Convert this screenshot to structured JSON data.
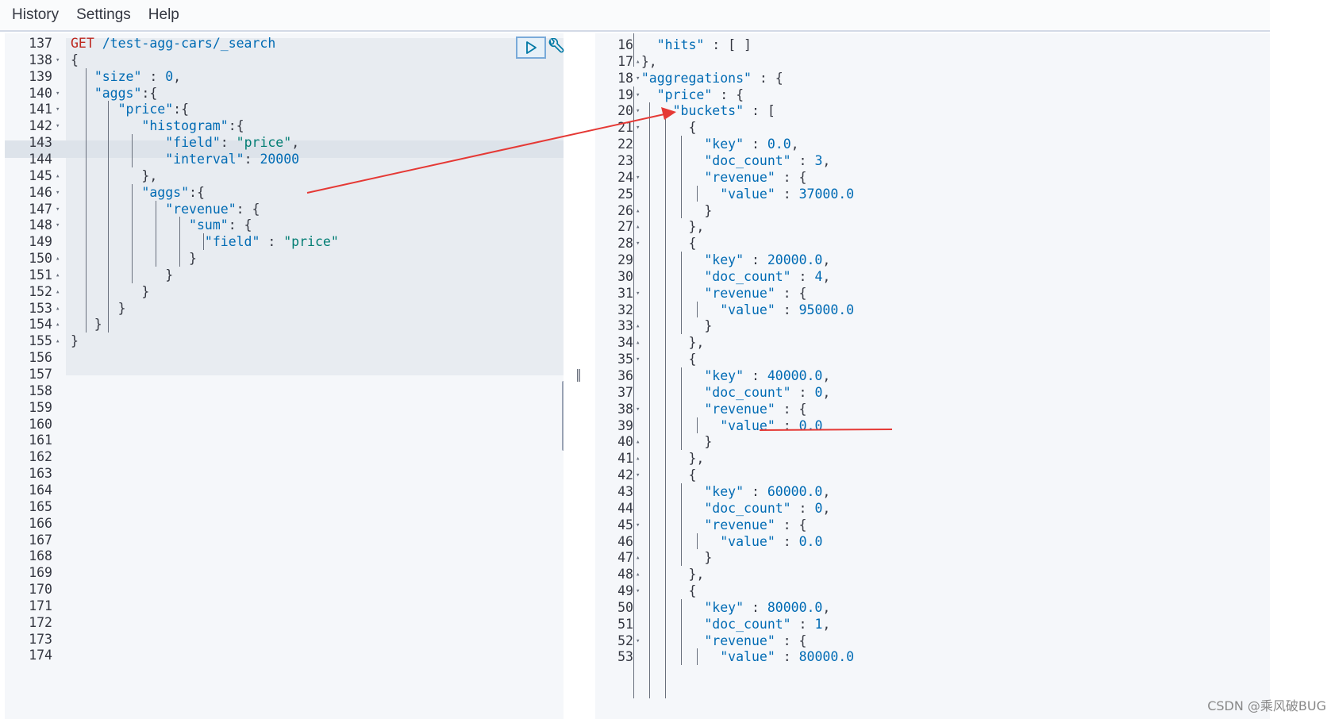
{
  "menu": [
    "History",
    "Settings",
    "Help"
  ],
  "icons": {
    "play": "play-triangle-icon",
    "wrench": "wrench-icon",
    "splitter": "drag-handle-icon"
  },
  "colors": {
    "key": "#006bb4",
    "string": "#017d73",
    "method": "#bd271e",
    "annotation": "#e53935"
  },
  "request": {
    "method": "GET",
    "url": "/test-agg-cars/_search",
    "lines": [
      {
        "n": "137",
        "fold": "",
        "t": [
          [
            "method",
            "GET"
          ],
          [
            "punc",
            " "
          ],
          [
            "url",
            "/test-agg-cars/_search"
          ]
        ]
      },
      {
        "n": "138",
        "fold": "▾",
        "t": [
          [
            "punc",
            "{"
          ]
        ]
      },
      {
        "n": "139",
        "fold": "",
        "t": [
          [
            "punc",
            "   "
          ],
          [
            "key",
            "\"size\""
          ],
          [
            "punc",
            " : "
          ],
          [
            "num",
            "0"
          ],
          [
            "punc",
            ","
          ]
        ]
      },
      {
        "n": "140",
        "fold": "▾",
        "t": [
          [
            "punc",
            "   "
          ],
          [
            "key",
            "\"aggs\""
          ],
          [
            "punc",
            ":{"
          ]
        ]
      },
      {
        "n": "141",
        "fold": "▾",
        "t": [
          [
            "punc",
            "      "
          ],
          [
            "key",
            "\"price\""
          ],
          [
            "punc",
            ":{"
          ]
        ]
      },
      {
        "n": "142",
        "fold": "▾",
        "t": [
          [
            "punc",
            "         "
          ],
          [
            "key",
            "\"histogram\""
          ],
          [
            "punc",
            ":{"
          ]
        ]
      },
      {
        "n": "143",
        "fold": "",
        "t": [
          [
            "punc",
            "            "
          ],
          [
            "key",
            "\"field\""
          ],
          [
            "punc",
            ": "
          ],
          [
            "str",
            "\"price\""
          ],
          [
            "punc",
            ","
          ]
        ]
      },
      {
        "n": "144",
        "fold": "",
        "t": [
          [
            "punc",
            "            "
          ],
          [
            "key",
            "\"interval\""
          ],
          [
            "punc",
            ": "
          ],
          [
            "num",
            "20000"
          ]
        ]
      },
      {
        "n": "145",
        "fold": "▴",
        "t": [
          [
            "punc",
            "         },"
          ]
        ]
      },
      {
        "n": "146",
        "fold": "▾",
        "t": [
          [
            "punc",
            "         "
          ],
          [
            "key",
            "\"aggs\""
          ],
          [
            "punc",
            ":{"
          ]
        ]
      },
      {
        "n": "147",
        "fold": "▾",
        "t": [
          [
            "punc",
            "            "
          ],
          [
            "key",
            "\"revenue\""
          ],
          [
            "punc",
            ": {"
          ]
        ]
      },
      {
        "n": "148",
        "fold": "▾",
        "t": [
          [
            "punc",
            "               "
          ],
          [
            "key",
            "\"sum\""
          ],
          [
            "punc",
            ": {"
          ]
        ]
      },
      {
        "n": "149",
        "fold": "",
        "t": [
          [
            "punc",
            "                 "
          ],
          [
            "key",
            "\"field\""
          ],
          [
            "punc",
            " : "
          ],
          [
            "str",
            "\"price\""
          ]
        ]
      },
      {
        "n": "150",
        "fold": "▴",
        "t": [
          [
            "punc",
            "               }"
          ]
        ]
      },
      {
        "n": "151",
        "fold": "▴",
        "t": [
          [
            "punc",
            "            }"
          ]
        ]
      },
      {
        "n": "152",
        "fold": "▴",
        "t": [
          [
            "punc",
            "         }"
          ]
        ]
      },
      {
        "n": "153",
        "fold": "▴",
        "t": [
          [
            "punc",
            "      }"
          ]
        ]
      },
      {
        "n": "154",
        "fold": "▴",
        "t": [
          [
            "punc",
            "   }"
          ]
        ]
      },
      {
        "n": "155",
        "fold": "▴",
        "t": [
          [
            "punc",
            "}"
          ]
        ]
      },
      {
        "n": "156",
        "fold": "",
        "t": []
      },
      {
        "n": "157",
        "fold": "",
        "t": []
      },
      {
        "n": "158",
        "fold": "",
        "t": []
      },
      {
        "n": "159",
        "fold": "",
        "t": []
      },
      {
        "n": "160",
        "fold": "",
        "t": []
      },
      {
        "n": "161",
        "fold": "",
        "t": []
      },
      {
        "n": "162",
        "fold": "",
        "t": []
      },
      {
        "n": "163",
        "fold": "",
        "t": []
      },
      {
        "n": "164",
        "fold": "",
        "t": []
      },
      {
        "n": "165",
        "fold": "",
        "t": []
      },
      {
        "n": "166",
        "fold": "",
        "t": []
      },
      {
        "n": "167",
        "fold": "",
        "t": []
      },
      {
        "n": "168",
        "fold": "",
        "t": []
      },
      {
        "n": "169",
        "fold": "",
        "t": []
      },
      {
        "n": "170",
        "fold": "",
        "t": []
      },
      {
        "n": "171",
        "fold": "",
        "t": []
      },
      {
        "n": "172",
        "fold": "",
        "t": []
      },
      {
        "n": "173",
        "fold": "",
        "t": []
      },
      {
        "n": "174",
        "fold": "",
        "t": []
      }
    ]
  },
  "response": {
    "lines": [
      {
        "n": "16",
        "fold": "",
        "t": [
          [
            "punc",
            "    "
          ],
          [
            "key",
            "\"hits\""
          ],
          [
            "punc",
            " : [ ]"
          ]
        ]
      },
      {
        "n": "17",
        "fold": "▴",
        "t": [
          [
            "punc",
            "  },"
          ]
        ]
      },
      {
        "n": "18",
        "fold": "▾",
        "t": [
          [
            "punc",
            "  "
          ],
          [
            "key",
            "\"aggregations\""
          ],
          [
            "punc",
            " : {"
          ]
        ]
      },
      {
        "n": "19",
        "fold": "▾",
        "t": [
          [
            "punc",
            "    "
          ],
          [
            "key",
            "\"price\""
          ],
          [
            "punc",
            " : {"
          ]
        ]
      },
      {
        "n": "20",
        "fold": "▾",
        "t": [
          [
            "punc",
            "      "
          ],
          [
            "key",
            "\"buckets\""
          ],
          [
            "punc",
            " : ["
          ]
        ]
      },
      {
        "n": "21",
        "fold": "▾",
        "t": [
          [
            "punc",
            "        {"
          ]
        ]
      },
      {
        "n": "22",
        "fold": "",
        "t": [
          [
            "punc",
            "          "
          ],
          [
            "key",
            "\"key\""
          ],
          [
            "punc",
            " : "
          ],
          [
            "num",
            "0.0"
          ],
          [
            "punc",
            ","
          ]
        ]
      },
      {
        "n": "23",
        "fold": "",
        "t": [
          [
            "punc",
            "          "
          ],
          [
            "key",
            "\"doc_count\""
          ],
          [
            "punc",
            " : "
          ],
          [
            "num",
            "3"
          ],
          [
            "punc",
            ","
          ]
        ]
      },
      {
        "n": "24",
        "fold": "▾",
        "t": [
          [
            "punc",
            "          "
          ],
          [
            "key",
            "\"revenue\""
          ],
          [
            "punc",
            " : {"
          ]
        ]
      },
      {
        "n": "25",
        "fold": "",
        "t": [
          [
            "punc",
            "            "
          ],
          [
            "key",
            "\"value\""
          ],
          [
            "punc",
            " : "
          ],
          [
            "num",
            "37000.0"
          ]
        ]
      },
      {
        "n": "26",
        "fold": "▴",
        "t": [
          [
            "punc",
            "          }"
          ]
        ]
      },
      {
        "n": "27",
        "fold": "▴",
        "t": [
          [
            "punc",
            "        },"
          ]
        ]
      },
      {
        "n": "28",
        "fold": "▾",
        "t": [
          [
            "punc",
            "        {"
          ]
        ]
      },
      {
        "n": "29",
        "fold": "",
        "t": [
          [
            "punc",
            "          "
          ],
          [
            "key",
            "\"key\""
          ],
          [
            "punc",
            " : "
          ],
          [
            "num",
            "20000.0"
          ],
          [
            "punc",
            ","
          ]
        ]
      },
      {
        "n": "30",
        "fold": "",
        "t": [
          [
            "punc",
            "          "
          ],
          [
            "key",
            "\"doc_count\""
          ],
          [
            "punc",
            " : "
          ],
          [
            "num",
            "4"
          ],
          [
            "punc",
            ","
          ]
        ]
      },
      {
        "n": "31",
        "fold": "▾",
        "t": [
          [
            "punc",
            "          "
          ],
          [
            "key",
            "\"revenue\""
          ],
          [
            "punc",
            " : {"
          ]
        ]
      },
      {
        "n": "32",
        "fold": "",
        "t": [
          [
            "punc",
            "            "
          ],
          [
            "key",
            "\"value\""
          ],
          [
            "punc",
            " : "
          ],
          [
            "num",
            "95000.0"
          ]
        ]
      },
      {
        "n": "33",
        "fold": "▴",
        "t": [
          [
            "punc",
            "          }"
          ]
        ]
      },
      {
        "n": "34",
        "fold": "▴",
        "t": [
          [
            "punc",
            "        },"
          ]
        ]
      },
      {
        "n": "35",
        "fold": "▾",
        "t": [
          [
            "punc",
            "        {"
          ]
        ]
      },
      {
        "n": "36",
        "fold": "",
        "t": [
          [
            "punc",
            "          "
          ],
          [
            "key",
            "\"key\""
          ],
          [
            "punc",
            " : "
          ],
          [
            "num",
            "40000.0"
          ],
          [
            "punc",
            ","
          ]
        ]
      },
      {
        "n": "37",
        "fold": "",
        "t": [
          [
            "punc",
            "          "
          ],
          [
            "key",
            "\"doc_count\""
          ],
          [
            "punc",
            " : "
          ],
          [
            "num",
            "0"
          ],
          [
            "punc",
            ","
          ]
        ]
      },
      {
        "n": "38",
        "fold": "▾",
        "t": [
          [
            "punc",
            "          "
          ],
          [
            "key",
            "\"revenue\""
          ],
          [
            "punc",
            " : {"
          ]
        ]
      },
      {
        "n": "39",
        "fold": "",
        "t": [
          [
            "punc",
            "            "
          ],
          [
            "key",
            "\"value\""
          ],
          [
            "punc",
            " : "
          ],
          [
            "num",
            "0.0"
          ]
        ]
      },
      {
        "n": "40",
        "fold": "▴",
        "t": [
          [
            "punc",
            "          }"
          ]
        ]
      },
      {
        "n": "41",
        "fold": "▴",
        "t": [
          [
            "punc",
            "        },"
          ]
        ]
      },
      {
        "n": "42",
        "fold": "▾",
        "t": [
          [
            "punc",
            "        {"
          ]
        ]
      },
      {
        "n": "43",
        "fold": "",
        "t": [
          [
            "punc",
            "          "
          ],
          [
            "key",
            "\"key\""
          ],
          [
            "punc",
            " : "
          ],
          [
            "num",
            "60000.0"
          ],
          [
            "punc",
            ","
          ]
        ]
      },
      {
        "n": "44",
        "fold": "",
        "t": [
          [
            "punc",
            "          "
          ],
          [
            "key",
            "\"doc_count\""
          ],
          [
            "punc",
            " : "
          ],
          [
            "num",
            "0"
          ],
          [
            "punc",
            ","
          ]
        ]
      },
      {
        "n": "45",
        "fold": "▾",
        "t": [
          [
            "punc",
            "          "
          ],
          [
            "key",
            "\"revenue\""
          ],
          [
            "punc",
            " : {"
          ]
        ]
      },
      {
        "n": "46",
        "fold": "",
        "t": [
          [
            "punc",
            "            "
          ],
          [
            "key",
            "\"value\""
          ],
          [
            "punc",
            " : "
          ],
          [
            "num",
            "0.0"
          ]
        ]
      },
      {
        "n": "47",
        "fold": "▴",
        "t": [
          [
            "punc",
            "          }"
          ]
        ]
      },
      {
        "n": "48",
        "fold": "▴",
        "t": [
          [
            "punc",
            "        },"
          ]
        ]
      },
      {
        "n": "49",
        "fold": "▾",
        "t": [
          [
            "punc",
            "        {"
          ]
        ]
      },
      {
        "n": "50",
        "fold": "",
        "t": [
          [
            "punc",
            "          "
          ],
          [
            "key",
            "\"key\""
          ],
          [
            "punc",
            " : "
          ],
          [
            "num",
            "80000.0"
          ],
          [
            "punc",
            ","
          ]
        ]
      },
      {
        "n": "51",
        "fold": "",
        "t": [
          [
            "punc",
            "          "
          ],
          [
            "key",
            "\"doc_count\""
          ],
          [
            "punc",
            " : "
          ],
          [
            "num",
            "1"
          ],
          [
            "punc",
            ","
          ]
        ]
      },
      {
        "n": "52",
        "fold": "▾",
        "t": [
          [
            "punc",
            "          "
          ],
          [
            "key",
            "\"revenue\""
          ],
          [
            "punc",
            " : {"
          ]
        ]
      },
      {
        "n": "53",
        "fold": "",
        "t": [
          [
            "punc",
            "            "
          ],
          [
            "key",
            "\"value\""
          ],
          [
            "punc",
            " : "
          ],
          [
            "num",
            "80000.0"
          ]
        ]
      }
    ]
  },
  "watermark": "CSDN @乘风破BUG"
}
